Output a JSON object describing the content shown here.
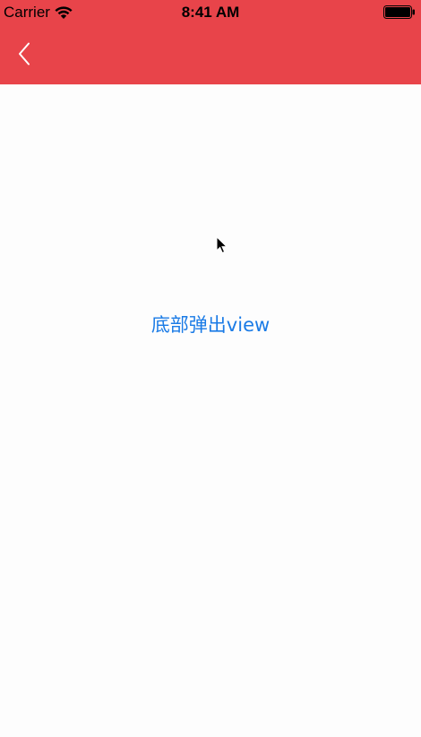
{
  "status_bar": {
    "carrier": "Carrier",
    "time": "8:41 AM",
    "icons": [
      "wifi-icon",
      "battery-icon"
    ]
  },
  "nav": {
    "back_icon": "chevron-left-icon",
    "background_color": "#e8444a"
  },
  "main": {
    "popup_button_label": "底部弹出view",
    "accent_color": "#1a7be6"
  }
}
